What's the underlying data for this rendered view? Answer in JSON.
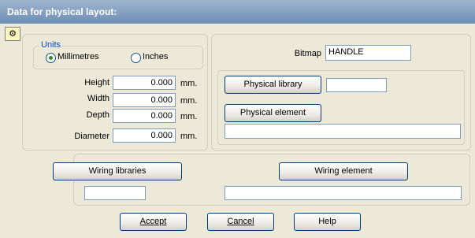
{
  "window": {
    "title": "Data for physical layout:",
    "icon": "app-icon"
  },
  "units": {
    "group_label": "Units",
    "options": [
      {
        "label": "Millimetres",
        "selected": true
      },
      {
        "label": "Inches",
        "selected": false
      }
    ]
  },
  "dimensions": {
    "height": {
      "label": "Height",
      "value": "0.000",
      "unit": "mm."
    },
    "width": {
      "label": "Width",
      "value": "0.000",
      "unit": "mm."
    },
    "depth": {
      "label": "Depth",
      "value": "0.000",
      "unit": "mm."
    },
    "diameter": {
      "label": "Diameter",
      "value": "0.000",
      "unit": "mm."
    }
  },
  "bitmap": {
    "label": "Bitmap",
    "value": "HANDLE"
  },
  "physical": {
    "library_button": "Physical library",
    "library_value": "",
    "element_button": "Physical element",
    "element_value": ""
  },
  "wiring": {
    "libraries_button": "Wiring libraries",
    "libraries_value": "",
    "element_button": "Wiring element",
    "element_value": ""
  },
  "buttons": {
    "accept": "Accept",
    "cancel": "Cancel",
    "help": "Help"
  }
}
